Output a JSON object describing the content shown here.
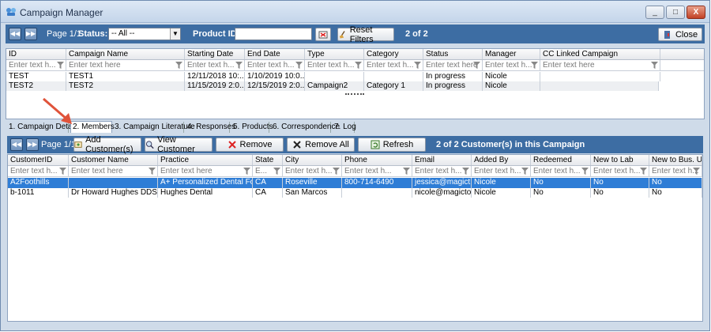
{
  "window": {
    "title": "Campaign Manager",
    "controls": [
      "_",
      "□",
      "X"
    ]
  },
  "top_toolbar": {
    "page": "Page 1/1",
    "status_label": "Status:",
    "status_value": "-- All --",
    "product_label": "Product ID:",
    "product_value": "",
    "reset_label": "Reset Filters",
    "count": "2 of 2",
    "close_label": "Close"
  },
  "campaign_grid": {
    "filter_placeholder": "Enter text h...",
    "columns": [
      "ID",
      "Campaign Name",
      "Starting Date",
      "End Date",
      "Type",
      "Category",
      "Status",
      "Manager",
      "CC Linked Campaign"
    ],
    "filters": [
      "Enter text h...",
      "Enter text here",
      "Enter text h...",
      "Enter text h...",
      "Enter text h...",
      "Enter text h...",
      "Enter text here",
      "Enter text h...",
      "Enter text here"
    ],
    "rows": [
      [
        "TEST",
        "TEST1",
        "12/11/2018 10:...",
        "1/10/2019 10:0...",
        "",
        "",
        "In progress",
        "Nicole",
        ""
      ],
      [
        "TEST2",
        "TEST2",
        "11/15/2019 2:0...",
        "12/15/2019 2:0...",
        "Campaign2",
        "Category 1",
        "In progress",
        "Nicole",
        ""
      ]
    ]
  },
  "tabs": [
    "1. Campaign Details",
    "2. Members",
    "3. Campaign Literature",
    "4. Responses",
    "5. Products",
    "6. Correspondence",
    "7. Log"
  ],
  "members_toolbar": {
    "page": "Page 1/1",
    "add_label": "Add Customer(s)",
    "view_label": "View Customer",
    "remove_label": "Remove",
    "remove_all_label": "Remove All",
    "refresh_label": "Refresh",
    "summary": "2 of 2 Customer(s) in this Campaign"
  },
  "members_grid": {
    "columns": [
      "CustomerID",
      "Customer Name",
      "Practice",
      "State",
      "City",
      "Phone",
      "Email",
      "Added By",
      "Redeemed",
      "New to Lab",
      "New to Bus. Unit"
    ],
    "filters": [
      "Enter text h...",
      "Enter text here",
      "Enter text here",
      "E...",
      "Enter text h...",
      "Enter text h...",
      "Enter text h...",
      "Enter text h...",
      "Enter text h...",
      "Enter text h...",
      "Enter text h..."
    ],
    "rows": [
      [
        "A2Foothills",
        "",
        "A+ Personalized Dental Foo...",
        "CA",
        "Roseville",
        "800-714-6490",
        "jessica@magict...",
        "Nicole",
        "No",
        "No",
        "No"
      ],
      [
        "b-1011",
        "Dr Howard Hughes DDS",
        "Hughes Dental",
        "CA",
        "San Marcos",
        "",
        "nicole@magicto...",
        "Nicole",
        "No",
        "No",
        "No"
      ]
    ]
  },
  "colors": {
    "toolbar_bg": "#3d6da3",
    "selected_row": "#2e7dd6",
    "annotation_arrow": "#e0533a"
  }
}
